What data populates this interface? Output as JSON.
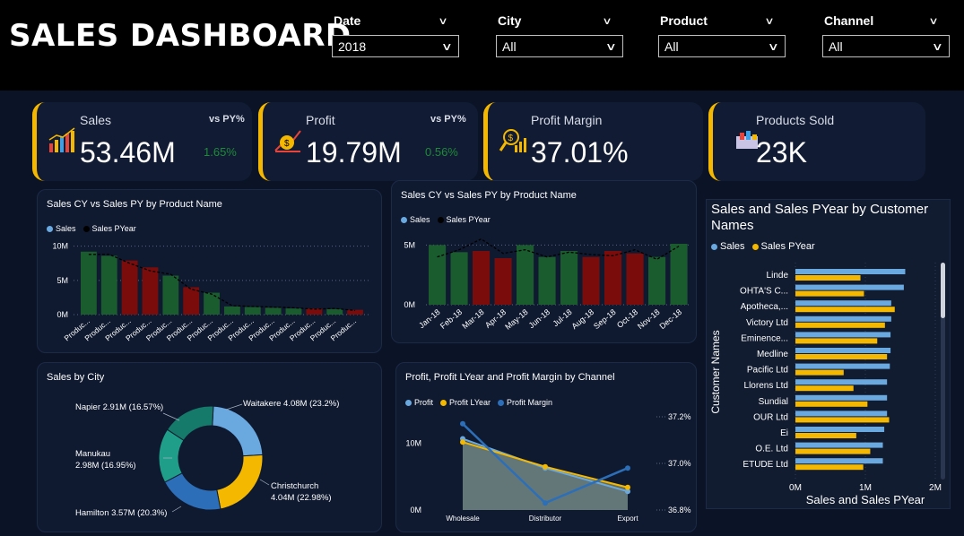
{
  "header": {
    "title": "SALES DASHBOARD"
  },
  "slicers": [
    {
      "label": "Date",
      "value": "2018"
    },
    {
      "label": "City",
      "value": "All"
    },
    {
      "label": "Product",
      "value": "All"
    },
    {
      "label": "Channel",
      "value": "All"
    }
  ],
  "kpis": {
    "sales": {
      "label": "Sales",
      "vs": "vs PY%",
      "value": "53.46M",
      "change": "1.65%"
    },
    "profit": {
      "label": "Profit",
      "vs": "vs PY%",
      "value": "19.79M",
      "change": "0.56%"
    },
    "margin": {
      "label": "Profit Margin",
      "value": "37.01%"
    },
    "sold": {
      "label": "Products Sold",
      "value": "23K"
    }
  },
  "colors": {
    "accent": "#f5b800",
    "green": "#1a5c2e",
    "red": "#7a0c0c",
    "blue": "#6aa9e0",
    "yellow": "#f5b800",
    "teal": "#1f9e89",
    "darkblue": "#2c6fb8"
  },
  "chart_data": [
    {
      "type": "bar",
      "title": "Sales CY vs Sales PY by Product Name",
      "legend": [
        "Sales",
        "Sales PYear"
      ],
      "categories": [
        "Produc...",
        "Produc...",
        "Produc...",
        "Produc...",
        "Produc...",
        "Produc...",
        "Produc...",
        "Produc...",
        "Produc...",
        "Produc...",
        "Produc...",
        "Produc...",
        "Produc...",
        "Produc..."
      ],
      "series": [
        {
          "name": "Sales",
          "values": [
            9.2,
            8.6,
            7.9,
            6.9,
            5.7,
            4.0,
            3.2,
            1.2,
            1.1,
            1.0,
            0.9,
            0.9,
            0.8,
            0.7
          ]
        },
        {
          "name": "Sales PYear",
          "values": [
            8.8,
            8.8,
            7.5,
            6.4,
            5.9,
            3.7,
            3.0,
            1.3,
            1.2,
            1.1,
            1.0,
            0.8,
            0.9,
            0.6
          ]
        }
      ],
      "bar_colors": [
        "green",
        "green",
        "red",
        "red",
        "green",
        "red",
        "green",
        "green",
        "green",
        "green",
        "green",
        "red",
        "green",
        "red"
      ],
      "yticks": [
        "10M",
        "5M",
        "0M"
      ],
      "ylim": [
        0,
        11
      ]
    },
    {
      "type": "bar",
      "title": "Sales CY vs Sales PY by Product Name",
      "legend": [
        "Sales",
        "Sales PYear"
      ],
      "categories": [
        "Jan-18",
        "Feb-18",
        "Mar-18",
        "Apr-18",
        "May-18",
        "Jun-18",
        "Jul-18",
        "Aug-18",
        "Sep-18",
        "Oct-18",
        "Nov-18",
        "Dec-18"
      ],
      "series": [
        {
          "name": "Sales",
          "values": [
            5.0,
            4.4,
            4.5,
            3.9,
            5.0,
            4.0,
            4.5,
            4.0,
            4.5,
            4.3,
            4.0,
            5.1
          ]
        },
        {
          "name": "Sales PYear",
          "values": [
            4.0,
            4.6,
            5.5,
            4.3,
            4.6,
            4.0,
            4.4,
            4.2,
            4.1,
            4.6,
            3.8,
            4.9
          ]
        }
      ],
      "bar_colors": [
        "green",
        "green",
        "red",
        "red",
        "green",
        "green",
        "green",
        "red",
        "red",
        "red",
        "green",
        "green"
      ],
      "yticks": [
        "5M",
        "0M"
      ],
      "ylim": [
        0,
        6
      ]
    },
    {
      "type": "pie",
      "title": "Sales by City",
      "labels": [
        "Waitakere",
        "Christchurch",
        "Hamilton",
        "Manukau",
        "Napier"
      ],
      "values": [
        4.08,
        4.04,
        3.57,
        2.98,
        2.91
      ],
      "label_texts": [
        "Waitakere 4.08M (23.2%)",
        "Christchurch",
        "4.04M (22.98%)",
        "Hamilton 3.57M (20.3%)",
        "Manukau",
        "2.98M (16.95%)",
        "Napier 2.91M (16.57%)"
      ]
    },
    {
      "type": "area",
      "title": "Profit, Profit LYear and Profit Margin by Channel",
      "legend": [
        "Profit",
        "Profit LYear",
        "Profit Margin"
      ],
      "categories": [
        "Wholesale",
        "Distributor",
        "Export"
      ],
      "series": [
        {
          "name": "Profit",
          "values": [
            10.7,
            6.3,
            2.8
          ]
        },
        {
          "name": "Profit LYear",
          "values": [
            10.2,
            6.5,
            3.4
          ]
        },
        {
          "name": "Profit Margin",
          "values": [
            37.17,
            36.83,
            36.98
          ]
        }
      ],
      "yticks": [
        "10M",
        "0M"
      ],
      "y2ticks": [
        "37.2%",
        "37.0%",
        "36.8%"
      ],
      "ylim": [
        0,
        14
      ],
      "y2lim": [
        36.8,
        37.2
      ]
    },
    {
      "type": "bar",
      "orientation": "horizontal",
      "title": "Sales and Sales PYear by Customer Names",
      "legend": [
        "Sales",
        "Sales PYear"
      ],
      "ylabel": "Customer Names",
      "xlabel": "Sales and Sales PYear",
      "categories": [
        "Linde",
        "OHTA'S C...",
        "Apotheca,...",
        "Victory Ltd",
        "Eminence...",
        "Medline",
        "Pacific Ltd",
        "Llorens Ltd",
        "Sundial",
        "OUR Ltd",
        "Ei",
        "O.E. Ltd",
        "ETUDE Ltd"
      ],
      "series": [
        {
          "name": "Sales",
          "values": [
            1.57,
            1.55,
            1.37,
            1.37,
            1.36,
            1.36,
            1.35,
            1.31,
            1.31,
            1.31,
            1.27,
            1.25,
            1.25
          ]
        },
        {
          "name": "Sales PYear",
          "values": [
            0.93,
            0.98,
            1.42,
            1.28,
            1.17,
            1.31,
            0.69,
            0.83,
            1.03,
            1.34,
            0.87,
            1.07,
            0.97
          ]
        }
      ],
      "xticks": [
        "0M",
        "1M",
        "2M"
      ],
      "xlim": [
        0,
        2
      ]
    }
  ]
}
